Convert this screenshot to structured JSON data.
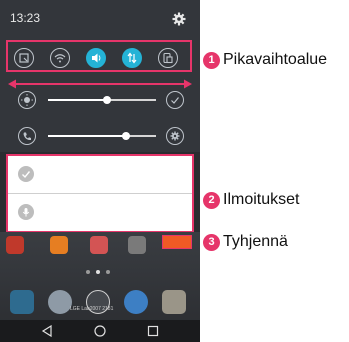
{
  "status_bar": {
    "time": "13:23",
    "settings_icon": "gear-icon"
  },
  "quick_settings": {
    "toggles": [
      {
        "name": "screen-capture",
        "icon": "screen-capture-icon",
        "on": false
      },
      {
        "name": "wifi",
        "icon": "wifi-icon",
        "on": false
      },
      {
        "name": "sound",
        "icon": "sound-icon",
        "on": true
      },
      {
        "name": "data",
        "icon": "data-transfer-icon",
        "on": true
      },
      {
        "name": "rotation",
        "icon": "rotate-icon",
        "on": false
      }
    ]
  },
  "sliders": [
    {
      "name": "brightness",
      "icon": "brightness-icon",
      "end_icon": "check-circle-icon",
      "level": 0.55
    },
    {
      "name": "volume",
      "icon": "ringtone-icon",
      "end_icon": "gear-icon",
      "level": 0.72
    }
  ],
  "notifications": {
    "items": [
      {
        "icon": "check-icon"
      },
      {
        "icon": "mic-icon"
      }
    ]
  },
  "home_dock": {
    "label": "LGE Lab2007 2181"
  },
  "callouts": [
    {
      "number": "1",
      "label": "Pikavaihtoalue"
    },
    {
      "number": "2",
      "label": "Ilmoitukset"
    },
    {
      "number": "3",
      "label": "Tyhjennä"
    }
  ],
  "colors": {
    "accent_toggle": "#24b3d6",
    "highlight": "#e6356a",
    "clear_button": "#f05a25"
  }
}
